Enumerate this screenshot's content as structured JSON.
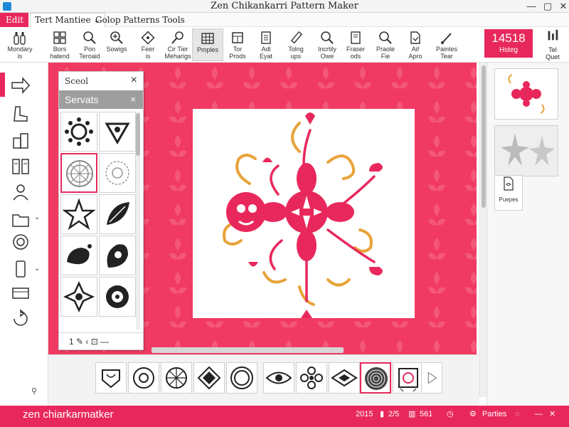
{
  "window": {
    "title": "Zen Chikankarri Pattern Maker"
  },
  "menubar": {
    "edit_label": "Edit",
    "tab_label": "Tert Mantiee",
    "tab_chevron": "⌄",
    "extra_label": "Golop Patterns Tools"
  },
  "toolbar": {
    "tools": [
      {
        "label": "Mondary\nis",
        "icon": "bottles-icon"
      },
      {
        "label": "Bors\nhatend",
        "icon": "grid-icon"
      },
      {
        "label": "Pon\nTeroaid",
        "icon": "search-icon"
      },
      {
        "label": "Sowigs",
        "icon": "search-plus-icon"
      },
      {
        "label": "Feer\nis",
        "icon": "stamp-icon"
      },
      {
        "label": "Cir Tier\nMeharigs",
        "icon": "magnifier-icon"
      },
      {
        "label": "Pmples",
        "icon": "table-icon"
      },
      {
        "label": "Tor\nProds",
        "icon": "frame-icon"
      },
      {
        "label": "Adl\nEyat",
        "icon": "document-icon"
      },
      {
        "label": "Tolng\nups",
        "icon": "pencil-icon"
      },
      {
        "label": "Incrtily\nOwe",
        "icon": "zoom-in-icon"
      },
      {
        "label": "Fraser\nods",
        "icon": "note-icon"
      },
      {
        "label": "Praole\nFie",
        "icon": "zoom-out-icon"
      },
      {
        "label": "Aif\nApro",
        "icon": "file-icon"
      },
      {
        "label": "Paintes\nTear",
        "icon": "brush-icon"
      }
    ],
    "counter_value": "14518",
    "counter_label": "Hsteg",
    "right_tool_label": "Tel\nQuet"
  },
  "stencil_panel": {
    "title": "Sceol",
    "subtitle": "Servats",
    "footer": "1   ✎   ‹   ⊡   —"
  },
  "right_panel": {
    "doc_label": "Puepes"
  },
  "statusbar": {
    "app_name": "zen chiarkarmatker",
    "year": "2015",
    "pages": "2/5",
    "code": "561",
    "mode": "Parties",
    "minimize": "—",
    "close": "✕"
  },
  "colors": {
    "accent": "#e8285c",
    "pattern_red": "#e8285c",
    "pattern_gold": "#e8a33a"
  }
}
